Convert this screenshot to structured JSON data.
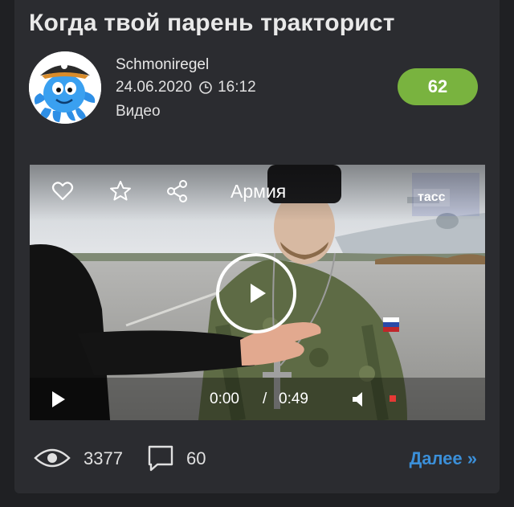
{
  "post": {
    "title": "Когда твой парень тракторист",
    "author": "Schmoniregel",
    "date": "24.06.2020",
    "time": "16:12",
    "category": "Видео",
    "rating": "62"
  },
  "video": {
    "tag_label": "Армия",
    "watermark": "тасс",
    "current_time": "0:00",
    "separator": "/",
    "duration": "0:49"
  },
  "stats": {
    "views": "3377",
    "comments": "60",
    "more_label": "Далее »"
  },
  "colors": {
    "background": "#1f2023",
    "card": "#2b2c30",
    "rating_badge": "#79b33f",
    "link": "#3b8fd8"
  },
  "icons": [
    "clock-icon",
    "heart-icon",
    "star-icon",
    "share-icon",
    "play-icon",
    "volume-icon",
    "eye-icon",
    "comment-icon"
  ]
}
